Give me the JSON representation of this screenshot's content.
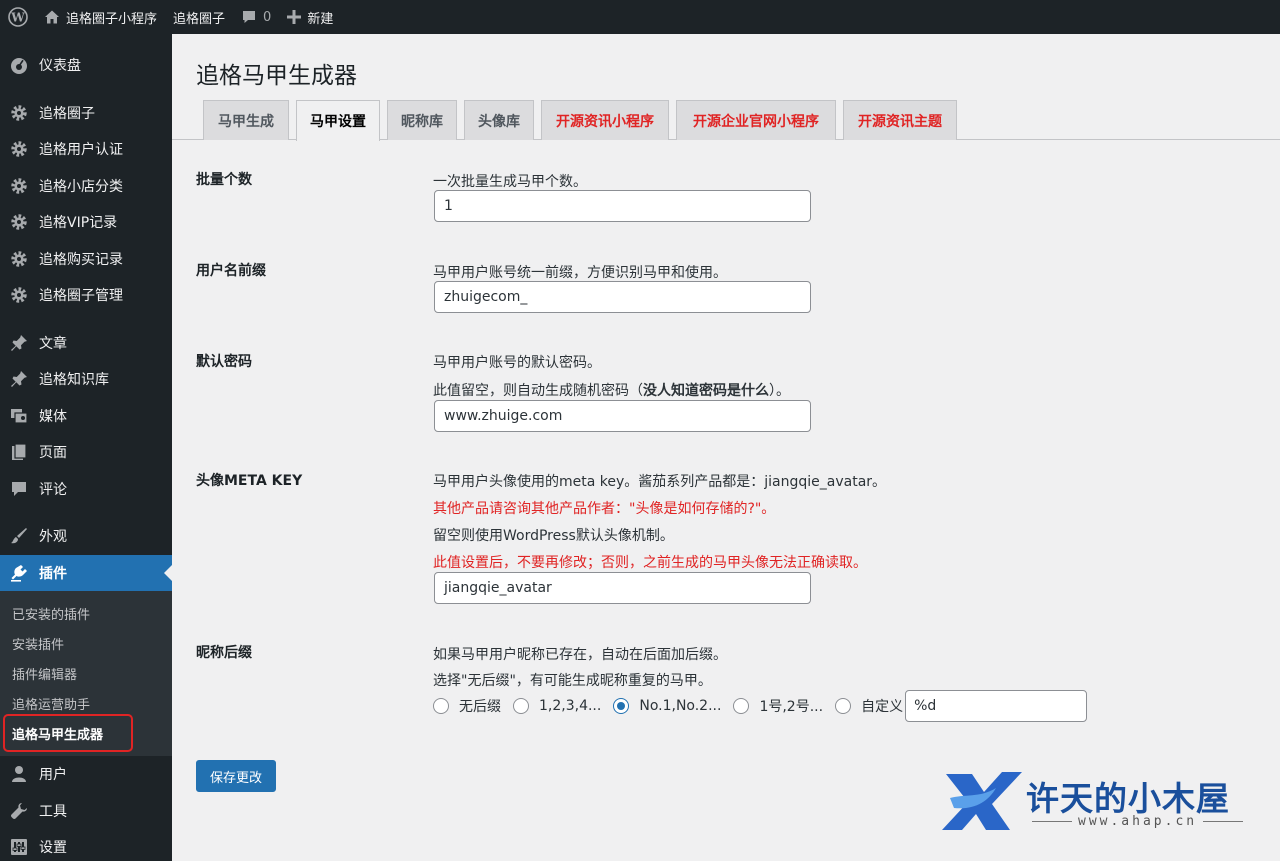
{
  "admin_bar": {
    "site_name": "追格圈子小程序",
    "link_2": "追格圈子",
    "comments_count": "0",
    "new_label": "新建"
  },
  "sidebar": {
    "items": [
      {
        "label": "仪表盘",
        "icon": "dashboard-icon"
      },
      {
        "label": "追格圈子",
        "icon": "gear-icon"
      },
      {
        "label": "追格用户认证",
        "icon": "gear-icon"
      },
      {
        "label": "追格小店分类",
        "icon": "gear-icon"
      },
      {
        "label": "追格VIP记录",
        "icon": "gear-icon"
      },
      {
        "label": "追格购买记录",
        "icon": "gear-icon"
      },
      {
        "label": "追格圈子管理",
        "icon": "gear-icon"
      },
      {
        "label": "文章",
        "icon": "pin-icon"
      },
      {
        "label": "追格知识库",
        "icon": "pin-icon"
      },
      {
        "label": "媒体",
        "icon": "media-icon"
      },
      {
        "label": "页面",
        "icon": "page-icon"
      },
      {
        "label": "评论",
        "icon": "comment-icon"
      },
      {
        "label": "外观",
        "icon": "brush-icon"
      },
      {
        "label": "插件",
        "icon": "plugin-icon"
      },
      {
        "label": "用户",
        "icon": "user-icon"
      },
      {
        "label": "工具",
        "icon": "wrench-icon"
      },
      {
        "label": "设置",
        "icon": "settings-icon"
      }
    ],
    "submenu": [
      "已安装的插件",
      "安装插件",
      "插件编辑器",
      "追格运营助手",
      "追格马甲生成器"
    ]
  },
  "page": {
    "title": "追格马甲生成器",
    "tabs": [
      {
        "label": "马甲生成"
      },
      {
        "label": "马甲设置"
      },
      {
        "label": "昵称库"
      },
      {
        "label": "头像库"
      },
      {
        "label": "开源资讯小程序"
      },
      {
        "label": "开源企业官网小程序"
      },
      {
        "label": "开源资讯主题"
      }
    ]
  },
  "settings": {
    "batch": {
      "label": "批量个数",
      "desc": "一次批量生成马甲个数。",
      "value": "1"
    },
    "prefix": {
      "label": "用户名前缀",
      "desc": "马甲用户账号统一前缀，方便识别马甲和使用。",
      "value": "zhuigecom_"
    },
    "password": {
      "label": "默认密码",
      "desc1": "马甲用户账号的默认密码。",
      "desc2_pre": "此值留空，则自动生成随机密码（",
      "desc2_bold": "没人知道密码是什么",
      "desc2_post": "）。",
      "value": "www.zhuige.com"
    },
    "avatar": {
      "label": "头像META KEY",
      "desc1": "马甲用户头像使用的meta key。酱茄系列产品都是：jiangqie_avatar。",
      "desc2": "其他产品请咨询其他产品作者：\"头像是如何存储的?\"。",
      "desc3": "留空则使用WordPress默认头像机制。",
      "desc4": "此值设置后，不要再修改；否则，之前生成的马甲头像无法正确读取。",
      "value": "jiangqie_avatar"
    },
    "suffix": {
      "label": "昵称后缀",
      "desc1": "如果马甲用户昵称已存在，自动在后面加后缀。",
      "desc2": "选择\"无后缀\"，有可能生成昵称重复的马甲。",
      "options": [
        "无后缀",
        "1,2,3,4...",
        "No.1,No.2...",
        "1号,2号...",
        "自定义"
      ],
      "selected": "No.1,No.2...",
      "custom_value": "%d"
    },
    "save_label": "保存更改"
  },
  "watermark": {
    "title": "许天的小木屋",
    "url": "www.ahap.cn"
  },
  "colors": {
    "accent": "#2271b1",
    "red": "#e02424",
    "sidebar": "#1d2327"
  }
}
